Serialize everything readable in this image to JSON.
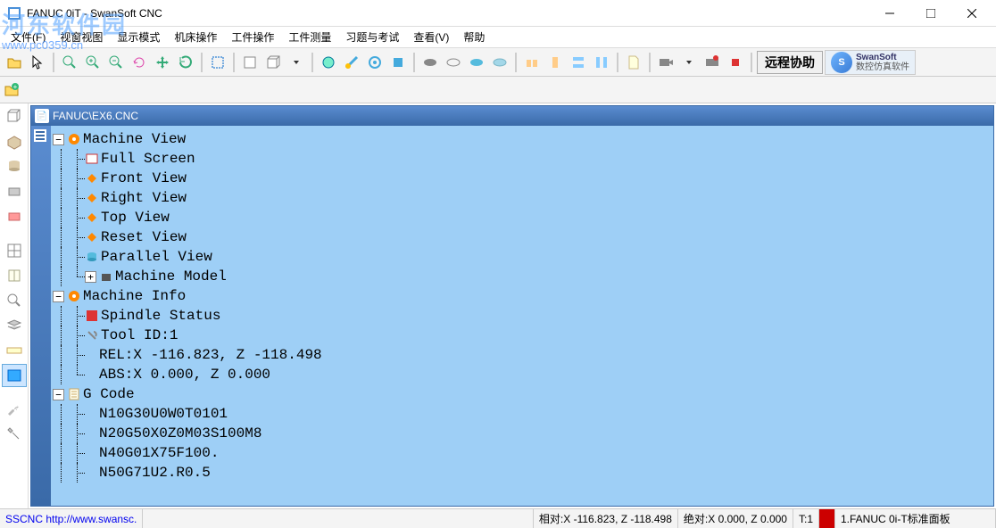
{
  "window": {
    "title": "FANUC 0iT - SwanSoft CNC"
  },
  "menu": {
    "items": [
      "文件(F)",
      "视窗视图",
      "显示模式",
      "机床操作",
      "工件操作",
      "工件测量",
      "习题与考试",
      "查看(V)",
      "帮助"
    ]
  },
  "toolbar": {
    "remote_label": "远程协助",
    "logo_line1": "SwanSoft",
    "logo_line2": "数控仿真软件"
  },
  "watermark": {
    "line1": "河东软件园",
    "line2": "www.pc0359.cn"
  },
  "main": {
    "file_header": "FANUC\\EX6.CNC",
    "tree": {
      "machine_view": {
        "label": "Machine View",
        "children": {
          "full_screen": "Full Screen",
          "front_view": "Front View",
          "right_view": "Right View",
          "top_view": "Top View",
          "reset_view": "Reset View",
          "parallel_view": "Parallel View",
          "machine_model": "Machine Model"
        }
      },
      "machine_info": {
        "label": "Machine Info",
        "children": {
          "spindle_status": "Spindle Status",
          "tool_id": "Tool ID:1",
          "rel": "REL:X -116.823, Z -118.498",
          "abs": "ABS:X    0.000, Z    0.000"
        }
      },
      "g_code": {
        "label": "G Code",
        "lines": [
          "N10G30U0W0T0101",
          "N20G50X0Z0M03S100M8",
          "N40G01X75F100.",
          "N50G71U2.R0.5"
        ]
      }
    }
  },
  "statusbar": {
    "link": "SSCNC http://www.swansc.",
    "rel": "相对:X -116.823, Z -118.498",
    "abs": "绝对:X    0.000, Z    0.000",
    "t": "T:1",
    "panel_sel": "1.FANUC 0i-T标准面板"
  }
}
